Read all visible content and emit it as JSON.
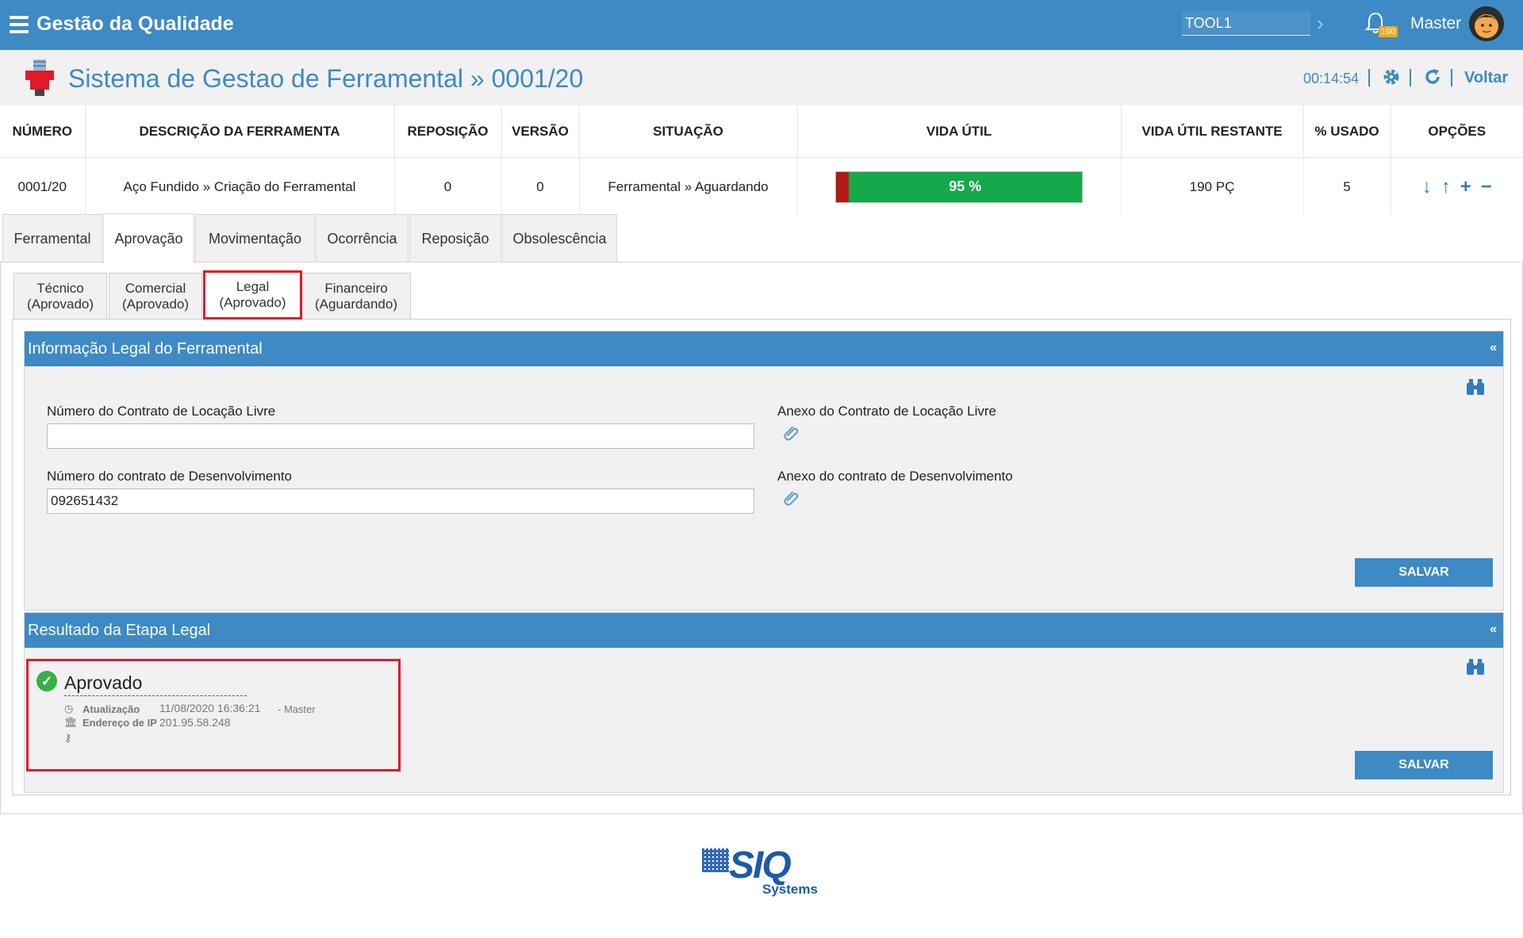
{
  "topbar": {
    "app_title": "Gestão da Qualidade",
    "tool_value": "TOOL1",
    "notification_count": "100",
    "user_name": "Master"
  },
  "header": {
    "title": "Sistema de Gestao de Ferramental » 0001/20",
    "timer": "00:14:54",
    "back_label": "Voltar"
  },
  "info_table": {
    "headers": [
      "NÚMERO",
      "DESCRIÇÃO DA FERRAMENTA",
      "REPOSIÇÃO",
      "VERSÃO",
      "SITUAÇÃO",
      "VIDA ÚTIL",
      "VIDA ÚTIL RESTANTE",
      "% USADO",
      "OPÇÕES"
    ],
    "row": {
      "numero": "0001/20",
      "descricao": "Aço Fundido » Criação do Ferramental",
      "reposicao": "0",
      "versao": "0",
      "situacao": "Ferramental » Aguardando",
      "vida_util_label": "95 %",
      "vida_util_remaining_fraction": 0.95,
      "vida_util_restante": "190 PÇ",
      "usado": "5"
    },
    "bar_colors": {
      "used": "#b11a16",
      "remaining": "#15a94a"
    }
  },
  "main_tabs": [
    "Ferramental",
    "Aprovação",
    "Movimentação",
    "Ocorrência",
    "Reposição",
    "Obsolescência"
  ],
  "main_tab_active": "Aprovação",
  "sub_tabs": [
    {
      "line1": "Técnico",
      "line2": "(Aprovado)"
    },
    {
      "line1": "Comercial",
      "line2": "(Aprovado)"
    },
    {
      "line1": "Legal",
      "line2": "(Aprovado)"
    },
    {
      "line1": "Financeiro",
      "line2": "(Aguardando)"
    }
  ],
  "sub_tab_active": "Legal",
  "legal_section": {
    "title": "Informação Legal do Ferramental",
    "collapse_symbol": "«",
    "contrato_locacao_label": "Número do Contrato de Locação Livre",
    "contrato_locacao_value": "",
    "anexo_locacao_label": "Anexo do Contrato de Locação Livre",
    "contrato_desenv_label": "Número do contrato de Desenvolvimento",
    "contrato_desenv_value": "092651432",
    "anexo_desenv_label": "Anexo do contrato de Desenvolvimento",
    "save_label": "SALVAR"
  },
  "result_section": {
    "title": "Resultado da Etapa Legal",
    "collapse_symbol": "«",
    "status": "Aprovado",
    "update_label": "Atualização",
    "update_value": "11/08/2020 16:36:21",
    "update_user": "- Master",
    "ip_label": "Endereço de IP",
    "ip_value": "201.95.58.248",
    "save_label": "SALVAR"
  },
  "footer": {
    "logo_main": "SIQ",
    "logo_sub": "Systems"
  },
  "colors": {
    "primary": "#3d8ac4",
    "highlight": "#e1192a",
    "success": "#35b049"
  }
}
